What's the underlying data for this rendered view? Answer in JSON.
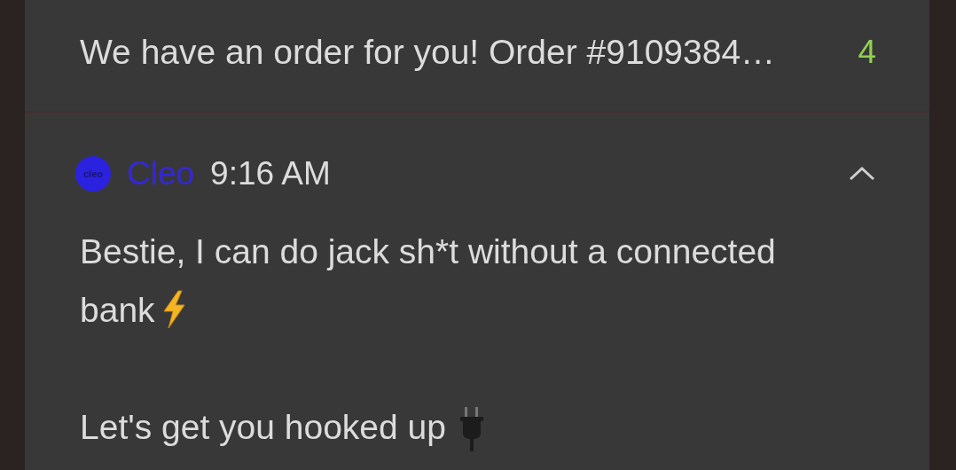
{
  "notifications": [
    {
      "kind": "collapsed",
      "preview": "We have an order for you! Order #9109384…",
      "count": "4"
    },
    {
      "kind": "expanded",
      "app_name": "Cleo",
      "logo_text": "cleo",
      "time": "9:16 AM",
      "expanded": true,
      "paragraphs": [
        {
          "lines": [
            "Bestie, I can do jack sh*t without a connected",
            "bank"
          ]
        },
        {
          "lines": [
            "Let's get you hooked up"
          ]
        }
      ]
    }
  ]
}
